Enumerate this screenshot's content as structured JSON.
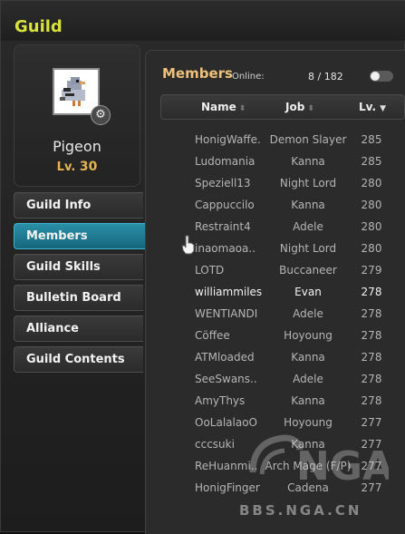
{
  "window": {
    "title": "Guild"
  },
  "profile": {
    "name": "Pigeon",
    "level_prefix": "Lv.",
    "level": "30",
    "emblem_icon": "pigeon-emblem-icon",
    "settings_icon": "gear-icon"
  },
  "menu": {
    "items": [
      {
        "label": "Guild Info",
        "active": false
      },
      {
        "label": "Members",
        "active": true
      },
      {
        "label": "Guild Skills",
        "active": false
      },
      {
        "label": "Bulletin Board",
        "active": false
      },
      {
        "label": "Alliance",
        "active": false
      },
      {
        "label": "Guild Contents",
        "active": false
      }
    ]
  },
  "members": {
    "title": "Members",
    "online_label": "Online:",
    "online_count": "8 / 182",
    "online_toggle": false,
    "columns": [
      "Name",
      "Job",
      "Lv."
    ],
    "rows": [
      {
        "name": "HonigWaffe...",
        "job": "Demon Slayer",
        "level": "285",
        "online": false
      },
      {
        "name": "Ludomania",
        "job": "Kanna",
        "level": "285",
        "online": false
      },
      {
        "name": "Speziell13",
        "job": "Night Lord",
        "level": "280",
        "online": false
      },
      {
        "name": "Cappuccilo",
        "job": "Kanna",
        "level": "280",
        "online": false
      },
      {
        "name": "Restraint4",
        "job": "Adele",
        "level": "280",
        "online": false
      },
      {
        "name": "inaomaoa..",
        "job": "Night Lord",
        "level": "280",
        "online": false
      },
      {
        "name": "LOTD",
        "job": "Buccaneer",
        "level": "279",
        "online": false
      },
      {
        "name": "williammiles",
        "job": "Evan",
        "level": "278",
        "online": true
      },
      {
        "name": "WENTIANDI",
        "job": "Adele",
        "level": "278",
        "online": false
      },
      {
        "name": "Cöffee",
        "job": "Hoyoung",
        "level": "278",
        "online": false
      },
      {
        "name": "ATMloaded",
        "job": "Kanna",
        "level": "278",
        "online": false
      },
      {
        "name": "SeeSwans..",
        "job": "Adele",
        "level": "278",
        "online": false
      },
      {
        "name": "AmyThys",
        "job": "Kanna",
        "level": "278",
        "online": false
      },
      {
        "name": "OoLalalaoO",
        "job": "Hoyoung",
        "level": "277",
        "online": false
      },
      {
        "name": "cccsuki",
        "job": "Kanna",
        "level": "277",
        "online": false
      },
      {
        "name": "ReHuanmi..",
        "job": "Arch Mage (F/P)",
        "level": "277",
        "online": false
      },
      {
        "name": "HonigFinger",
        "job": "Cadena",
        "level": "277",
        "online": false
      }
    ]
  },
  "watermark": {
    "logo_text": "NGA",
    "url_text": "BBS.NGA.CN"
  }
}
